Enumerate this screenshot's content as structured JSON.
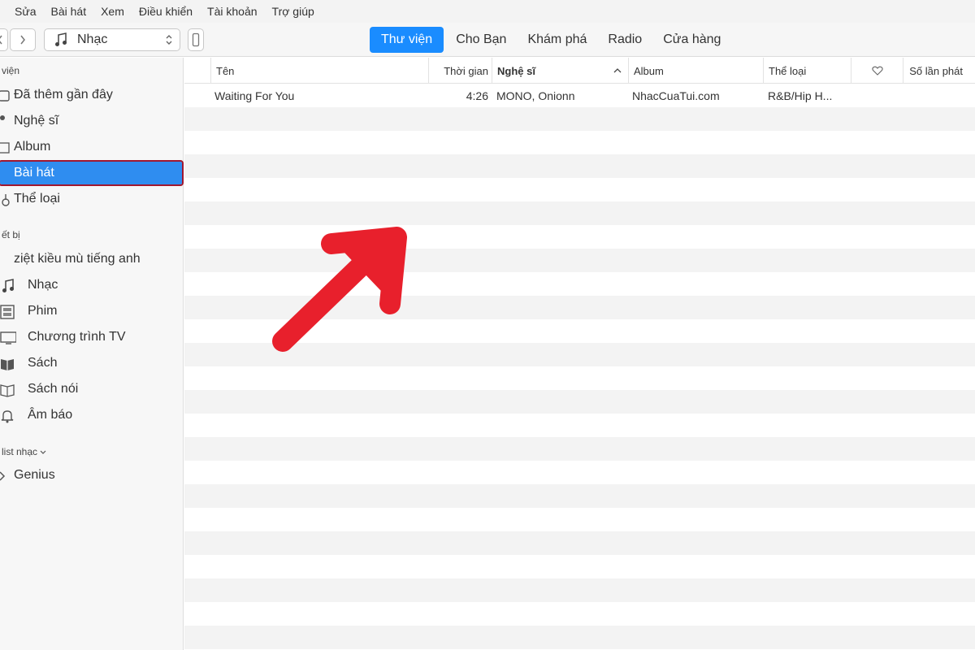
{
  "menu": [
    "Sửa",
    "Bài hát",
    "Xem",
    "Điều khiển",
    "Tài khoản",
    "Trợ giúp"
  ],
  "toolbar": {
    "media_select": "Nhạc",
    "tabs": [
      {
        "label": "Thư viện",
        "active": true
      },
      {
        "label": "Cho Bạn",
        "active": false
      },
      {
        "label": "Khám phá",
        "active": false
      },
      {
        "label": "Radio",
        "active": false
      },
      {
        "label": "Cửa hàng",
        "active": false
      }
    ],
    "accent": "#1a8cff"
  },
  "sidebar": {
    "library_header": "viện",
    "library_items": [
      {
        "label": "Đã thêm gần đây",
        "icon": "clock-icon"
      },
      {
        "label": "Nghệ sĩ",
        "icon": "microphone-icon"
      },
      {
        "label": "Album",
        "icon": "album-icon"
      },
      {
        "label": "Bài hát",
        "icon": "note-icon",
        "selected": true
      },
      {
        "label": "Thể loại",
        "icon": "guitar-icon"
      }
    ],
    "devices_header": "ết bị",
    "device_name": "ziệt kiều mù tiếng anh",
    "device_items": [
      {
        "label": "Nhạc",
        "icon": "music-note-icon"
      },
      {
        "label": "Phim",
        "icon": "film-icon"
      },
      {
        "label": "Chương trình TV",
        "icon": "tv-icon"
      },
      {
        "label": "Sách",
        "icon": "book-icon"
      },
      {
        "label": "Sách nói",
        "icon": "audiobook-icon"
      },
      {
        "label": "Âm báo",
        "icon": "bell-icon"
      }
    ],
    "playlists_header": "list nhạc",
    "playlist_items": [
      {
        "label": "Genius",
        "icon": "genius-icon"
      }
    ],
    "selected_color": "#2f8df0",
    "highlight_border": "#a01830"
  },
  "table": {
    "columns": {
      "name": "Tên",
      "time": "Thời gian",
      "artist": "Nghệ sĩ",
      "album": "Album",
      "genre": "Thể loại",
      "plays": "Số lần phát"
    },
    "rows": [
      {
        "name": "Waiting For You",
        "time": "4:26",
        "artist": "MONO, Onionn",
        "album": "NhacCuaTui.com",
        "genre": "R&B/Hip H..."
      }
    ]
  },
  "annotation_color": "#e8202c"
}
